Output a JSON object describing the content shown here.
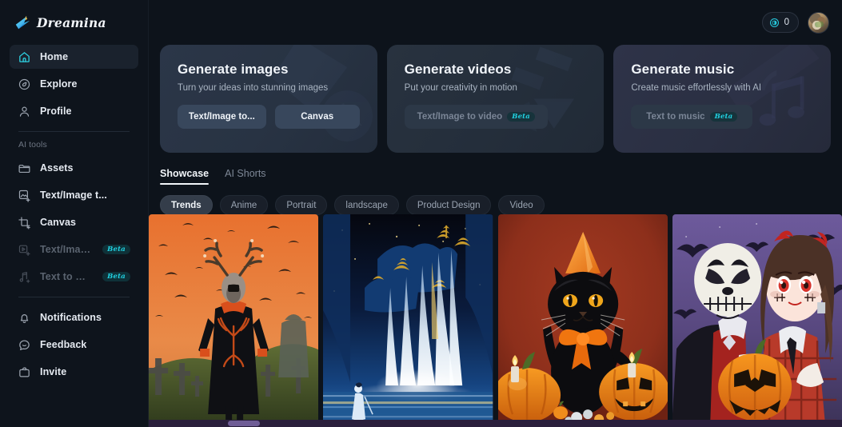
{
  "brand": {
    "name": "Dreamina",
    "logo_icon": "dreamina-star-logo"
  },
  "sidebar": {
    "primary": [
      {
        "label": "Home",
        "icon": "home-icon",
        "active": true,
        "disabled": false,
        "key": "home"
      },
      {
        "label": "Explore",
        "icon": "compass-icon",
        "active": false,
        "disabled": false,
        "key": "explore"
      },
      {
        "label": "Profile",
        "icon": "user-icon",
        "active": false,
        "disabled": false,
        "key": "profile"
      }
    ],
    "section_caption": "AI tools",
    "tools": [
      {
        "label": "Assets",
        "icon": "folder-icon",
        "disabled": false,
        "badge": "",
        "key": "assets"
      },
      {
        "label": "Text/Image t...",
        "icon": "image-plus-icon",
        "disabled": false,
        "badge": "",
        "key": "text-image-to-image"
      },
      {
        "label": "Canvas",
        "icon": "canvas-icon",
        "disabled": false,
        "badge": "",
        "key": "canvas"
      },
      {
        "label": "Text/Image t...",
        "icon": "video-plus-icon",
        "disabled": true,
        "badge": "Beta",
        "key": "text-image-to-video"
      },
      {
        "label": "Text to music",
        "icon": "music-plus-icon",
        "disabled": true,
        "badge": "Beta",
        "key": "text-to-music"
      }
    ],
    "secondary": [
      {
        "label": "Notifications",
        "icon": "bell-icon",
        "key": "notifications"
      },
      {
        "label": "Feedback",
        "icon": "message-icon",
        "key": "feedback"
      },
      {
        "label": "Invite",
        "icon": "invite-icon",
        "key": "invite"
      }
    ]
  },
  "topbar": {
    "credits_icon": "credit-coin-icon",
    "credits_value": "0",
    "avatar_icon": "user-avatar"
  },
  "hero_cards": [
    {
      "title": "Generate images",
      "subtitle": "Turn your ideas into stunning images",
      "buttons": [
        {
          "label": "Text/Image to...",
          "badge": "",
          "disabled": false
        },
        {
          "label": "Canvas",
          "badge": "",
          "disabled": false
        }
      ]
    },
    {
      "title": "Generate videos",
      "subtitle": "Put your creativity in motion",
      "buttons": [
        {
          "label": "Text/Image to video",
          "badge": "Beta",
          "disabled": true
        }
      ]
    },
    {
      "title": "Generate music",
      "subtitle": "Create music effortlessly with AI",
      "buttons": [
        {
          "label": "Text to music",
          "badge": "Beta",
          "disabled": true
        }
      ]
    }
  ],
  "tabs": [
    {
      "label": "Showcase",
      "active": true
    },
    {
      "label": "AI Shorts",
      "active": false
    }
  ],
  "chips": [
    {
      "label": "Trends",
      "active": true
    },
    {
      "label": "Anime",
      "active": false
    },
    {
      "label": "Portrait",
      "active": false
    },
    {
      "label": "landscape",
      "active": false
    },
    {
      "label": "Product Design",
      "active": false
    },
    {
      "label": "Video",
      "active": false
    }
  ],
  "gallery": [
    {
      "alt": "Stag-headed figure in hooded robe standing in a graveyard under an orange sky with flying bats"
    },
    {
      "alt": "Glowing blue waterfall at night with a robed figure standing on reflective water"
    },
    {
      "alt": "Black cat wearing an orange party hat and bow beside lit jack-o-lanterns"
    },
    {
      "alt": "Anime couple in Halloween costumes, one in a skull mask, holding a carved pumpkin"
    }
  ],
  "colors": {
    "accent_cyan": "#21d0e0",
    "sidebar_bg": "#0e141c",
    "main_bg": "#0d131b",
    "active_nav_bg": "#1a222d",
    "scrollbar_track": "#2a1f3c",
    "scrollbar_thumb": "#6f5d96"
  },
  "scrollbar": {
    "position_label": "horizontal-scrollbar"
  }
}
